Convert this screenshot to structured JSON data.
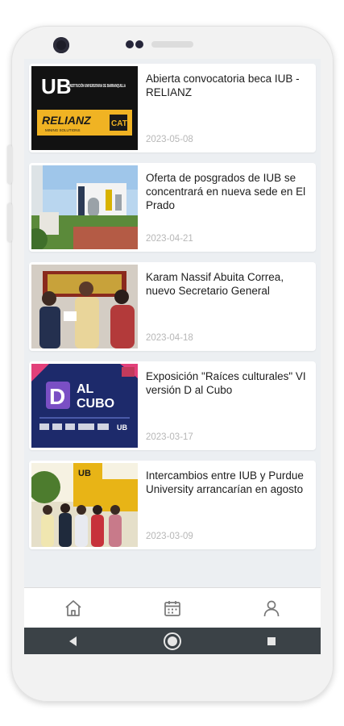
{
  "news": [
    {
      "title": "Abierta convocatoria beca IUB - RELIANZ",
      "date": "2023-05-08",
      "image": {
        "logo": "UB",
        "institution": "INSTITUCIÓN UNIVERSITARIA DE BARRANQUILLA",
        "partner": "RELIANZ",
        "partner_tagline": "MINING SOLUTIONS",
        "partner_badge": "CAT"
      }
    },
    {
      "title": "Oferta de posgrados de IUB se concentrará en nueva sede en El Prado",
      "date": "2023-04-21"
    },
    {
      "title": "Karam Nassif Abuita Correa, nuevo Secretario General",
      "date": "2023-04-18"
    },
    {
      "title": "Exposición \"Raíces culturales\" VI versión D al Cubo",
      "date": "2023-03-17",
      "image": {
        "line1": "AL",
        "line2": "CUBO",
        "letter": "D",
        "footer": "UB"
      }
    },
    {
      "title": "Intercambios entre IUB y Purdue University arrancarían en agosto",
      "date": "2023-03-09",
      "image": {
        "sign": "UB"
      }
    }
  ],
  "nav": {
    "items": [
      "home-icon",
      "calendar-icon",
      "profile-icon"
    ]
  },
  "system_nav": {
    "items": [
      "back-icon",
      "home-circle-icon",
      "recents-icon"
    ]
  },
  "colors": {
    "screen_bg": "#eceff2",
    "relianz_yellow": "#f0b323",
    "dcubo_navy": "#1d2a6b",
    "system_bar": "#3b4247"
  }
}
